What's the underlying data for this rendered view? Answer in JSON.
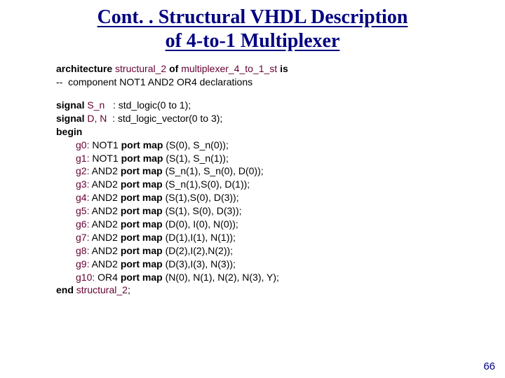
{
  "title_line1": "Cont. . Structural VHDL Description",
  "title_line2": "of 4-to-1 Multiplexer",
  "arch": {
    "kw1": "architecture ",
    "name": "structural_2",
    "kw2": " of ",
    "entity": "multiplexer_4_to_1_st",
    "kw3": " is"
  },
  "comment": "--  component NOT1 AND2 OR4 declarations",
  "sig1": {
    "kw": "signal ",
    "names": "S_n",
    "rest": "   : std_logic(0 to 1);"
  },
  "sig2": {
    "kw": "signal ",
    "names": "D, N",
    "rest": "  : std_logic_vector(0 to 3);"
  },
  "begin": "begin",
  "gates": [
    {
      "label": "g0:",
      "comp": " NOT1 ",
      "pm": "port map",
      "args": " (S(0), S_n(0));"
    },
    {
      "label": "g1:",
      "comp": " NOT1 ",
      "pm": "port map",
      "args": " (S(1), S_n(1));"
    },
    {
      "label": "g2:",
      "comp": " AND2 ",
      "pm": "port map",
      "args": " (S_n(1), S_n(0), D(0));"
    },
    {
      "label": "g3:",
      "comp": " AND2 ",
      "pm": "port map",
      "args": " (S_n(1),S(0), D(1));"
    },
    {
      "label": "g4:",
      "comp": " AND2 ",
      "pm": "port map",
      "args": " (S(1),S(0), D(3));"
    },
    {
      "label": "g5:",
      "comp": " AND2 ",
      "pm": "port map",
      "args": " (S(1), S(0), D(3));"
    },
    {
      "label": "g6:",
      "comp": " AND2 ",
      "pm": "port map",
      "args": " (D(0), I(0), N(0));"
    },
    {
      "label": "g7:",
      "comp": " AND2 ",
      "pm": "port map",
      "args": " (D(1),I(1), N(1));"
    },
    {
      "label": "g8:",
      "comp": " AND2 ",
      "pm": "port map",
      "args": " (D(2),I(2),N(2));"
    },
    {
      "label": "g9:",
      "comp": " AND2 ",
      "pm": "port map",
      "args": " (D(3),I(3), N(3));"
    },
    {
      "label": "g10:",
      "comp": " OR4 ",
      "pm": "port map",
      "args": " (N(0), N(1), N(2), N(3), Y);"
    }
  ],
  "end": {
    "kw": "end ",
    "name": "structural_2",
    "semi": ";"
  },
  "pagenum": "66"
}
